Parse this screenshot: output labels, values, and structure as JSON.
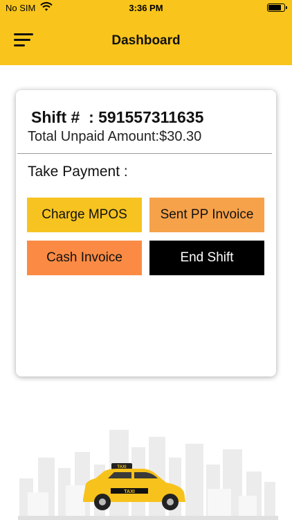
{
  "status_bar": {
    "carrier": "No SIM",
    "time": "3:36 PM",
    "battery_level": 0.85,
    "wifi_icon": "wifi-icon"
  },
  "header": {
    "title": "Dashboard",
    "menu_icon": "hamburger-menu-icon"
  },
  "card": {
    "shift_label": "Shift #",
    "shift_separator": ":",
    "shift_number": "591557311635",
    "unpaid_label": "Total Unpaid Amount:",
    "unpaid_value": "$30.30",
    "take_payment_label": "Take Payment :",
    "buttons": {
      "charge_mpos": "Charge MPOS",
      "sent_pp_invoice": "Sent PP Invoice",
      "cash_invoice": "Cash Invoice",
      "end_shift": "End Shift"
    }
  },
  "illustration": {
    "taxi_sign": "TAXI",
    "taxi_door_label": "TAXI"
  },
  "colors": {
    "brand_yellow": "#f9c51c",
    "charge_button": "#f6c321",
    "pp_button": "#f6a24a",
    "cash_button": "#fb8b44",
    "end_button": "#000000"
  }
}
